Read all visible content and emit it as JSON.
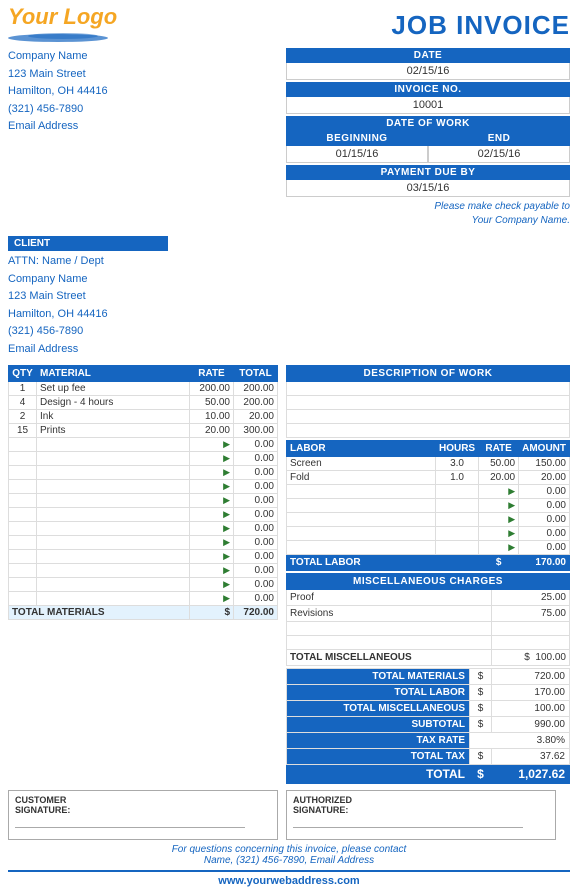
{
  "header": {
    "logo_text": "Your Logo",
    "invoice_title": "JOB INVOICE"
  },
  "company": {
    "name": "Company Name",
    "street": "123 Main Street",
    "city_state_zip": "Hamilton, OH  44416",
    "phone": "(321) 456-7890",
    "email": "Email Address"
  },
  "invoice_meta": {
    "date_label": "DATE",
    "date_value": "02/15/16",
    "invoice_no_label": "INVOICE NO.",
    "invoice_no_value": "10001",
    "date_of_work_label": "DATE OF WORK",
    "beginning_label": "BEGINNING",
    "end_label": "END",
    "beginning_value": "01/15/16",
    "end_value": "02/15/16",
    "payment_due_label": "PAYMENT DUE BY",
    "payment_due_value": "03/15/16",
    "payable_note_line1": "Please make check payable to",
    "payable_note_line2": "Your Company Name."
  },
  "client": {
    "label": "CLIENT",
    "attn": "ATTN: Name / Dept",
    "name": "Company Name",
    "street": "123 Main Street",
    "city_state_zip": "Hamilton, OH  44416",
    "phone": "(321) 456-7890",
    "email": "Email Address"
  },
  "materials": {
    "headers": [
      "QTY",
      "MATERIAL",
      "RATE",
      "TOTAL"
    ],
    "rows": [
      {
        "qty": "1",
        "material": "Set up fee",
        "rate": "200.00",
        "total": "200.00"
      },
      {
        "qty": "4",
        "material": "Design - 4 hours",
        "rate": "50.00",
        "total": "200.00"
      },
      {
        "qty": "2",
        "material": "Ink",
        "rate": "10.00",
        "total": "20.00"
      },
      {
        "qty": "15",
        "material": "Prints",
        "rate": "20.00",
        "total": "300.00"
      },
      {
        "qty": "",
        "material": "",
        "rate": "",
        "total": "0.00"
      },
      {
        "qty": "",
        "material": "",
        "rate": "",
        "total": "0.00"
      },
      {
        "qty": "",
        "material": "",
        "rate": "",
        "total": "0.00"
      },
      {
        "qty": "",
        "material": "",
        "rate": "",
        "total": "0.00"
      },
      {
        "qty": "",
        "material": "",
        "rate": "",
        "total": "0.00"
      },
      {
        "qty": "",
        "material": "",
        "rate": "",
        "total": "0.00"
      },
      {
        "qty": "",
        "material": "",
        "rate": "",
        "total": "0.00"
      },
      {
        "qty": "",
        "material": "",
        "rate": "",
        "total": "0.00"
      },
      {
        "qty": "",
        "material": "",
        "rate": "",
        "total": "0.00"
      },
      {
        "qty": "",
        "material": "",
        "rate": "",
        "total": "0.00"
      },
      {
        "qty": "",
        "material": "",
        "rate": "",
        "total": "0.00"
      },
      {
        "qty": "",
        "material": "",
        "rate": "",
        "total": "0.00"
      }
    ],
    "total_label": "TOTAL MATERIALS",
    "dollar": "$",
    "total_value": "720.00"
  },
  "description": {
    "label": "DESCRIPTION OF WORK",
    "rows": 4
  },
  "labor": {
    "headers": [
      "LABOR",
      "HOURS",
      "RATE",
      "AMOUNT"
    ],
    "rows": [
      {
        "labor": "Screen",
        "hours": "3.0",
        "rate": "50.00",
        "amount": "150.00"
      },
      {
        "labor": "Fold",
        "hours": "1.0",
        "rate": "20.00",
        "amount": "20.00"
      },
      {
        "labor": "",
        "hours": "",
        "rate": "",
        "amount": "0.00"
      },
      {
        "labor": "",
        "hours": "",
        "rate": "",
        "amount": "0.00"
      },
      {
        "labor": "",
        "hours": "",
        "rate": "",
        "amount": "0.00"
      },
      {
        "labor": "",
        "hours": "",
        "rate": "",
        "amount": "0.00"
      },
      {
        "labor": "",
        "hours": "",
        "rate": "",
        "amount": "0.00"
      }
    ],
    "total_label": "TOTAL LABOR",
    "dollar": "$",
    "total_value": "170.00"
  },
  "misc": {
    "label": "MISCELLANEOUS CHARGES",
    "rows": [
      {
        "description": "Proof",
        "amount": "25.00"
      },
      {
        "description": "Revisions",
        "amount": "75.00"
      },
      {
        "description": "",
        "amount": ""
      },
      {
        "description": "",
        "amount": ""
      }
    ],
    "total_label": "TOTAL MISCELLANEOUS",
    "dollar": "$",
    "total_value": "100.00"
  },
  "totals": {
    "total_materials_label": "TOTAL MATERIALS",
    "total_materials_dollar": "$",
    "total_materials_value": "720.00",
    "total_labor_label": "TOTAL LABOR",
    "total_labor_dollar": "$",
    "total_labor_value": "170.00",
    "total_misc_label": "TOTAL MISCELLANEOUS",
    "total_misc_dollar": "$",
    "total_misc_value": "100.00",
    "subtotal_label": "SUBTOTAL",
    "subtotal_dollar": "$",
    "subtotal_value": "990.00",
    "tax_rate_label": "TAX RATE",
    "tax_rate_value": "3.80%",
    "total_tax_label": "TOTAL TAX",
    "total_tax_dollar": "$",
    "total_tax_value": "37.62",
    "total_label": "TOTAL",
    "total_dollar": "$",
    "total_value": "1,027.62"
  },
  "signatures": {
    "customer_label": "CUSTOMER",
    "customer_sig_label": "SIGNATURE:",
    "authorized_label": "AUTHORIZED",
    "authorized_sig_label": "SIGNATURE:"
  },
  "footer": {
    "note_line1": "For questions concerning this invoice, please contact",
    "note_line2": "Name, (321) 456-7890, Email Address",
    "website": "www.yourwebaddress.com"
  }
}
